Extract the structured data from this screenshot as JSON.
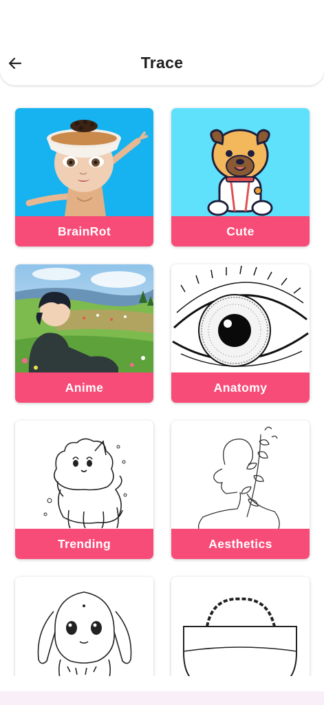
{
  "header": {
    "title": "Trace",
    "back_icon": "arrow-left-icon"
  },
  "categories": [
    {
      "label": "BrainRot"
    },
    {
      "label": "Cute"
    },
    {
      "label": "Anime"
    },
    {
      "label": "Anatomy"
    },
    {
      "label": "Trending"
    },
    {
      "label": "Aesthetics"
    }
  ],
  "colors": {
    "accent": "#f84c78",
    "title_text": "#1f1f1f",
    "card_label_text": "#ffffff",
    "bottom_strip": "#f9eff8"
  }
}
